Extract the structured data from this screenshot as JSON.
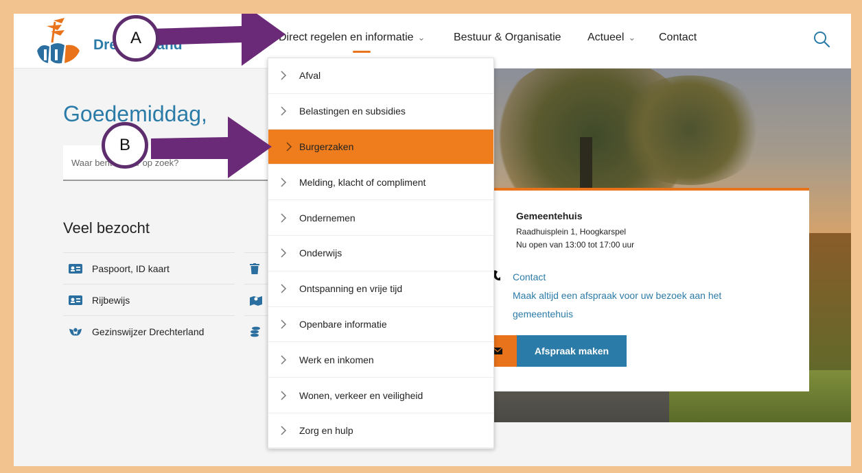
{
  "header": {
    "logo_text": "Drechterland",
    "nav": [
      {
        "label": "Direct regelen en informatie",
        "has_chevron": true
      },
      {
        "label": "Bestuur & Organisatie",
        "has_chevron": false
      },
      {
        "label": "Actueel",
        "has_chevron": true
      },
      {
        "label": "Contact",
        "has_chevron": false
      }
    ],
    "search_icon": "search-icon"
  },
  "main": {
    "greeting": "Goedemiddag,",
    "search_placeholder": "Waar bent u naar op zoek?",
    "popular_title": "Veel bezocht",
    "popular_items": [
      {
        "label": "Paspoort, ID kaart",
        "icon": "id-card-icon"
      },
      {
        "label": "Rijbewijs",
        "icon": "id-card-icon"
      },
      {
        "label": "Gezinswijzer Drechterland",
        "icon": "family-icon"
      }
    ],
    "popular_items_col2_icons": [
      "trash-icon",
      "map-icon",
      "coins-icon"
    ]
  },
  "dropdown": {
    "items": [
      "Afval",
      "Belastingen en subsidies",
      "Burgerzaken",
      "Melding, klacht of compliment",
      "Ondernemen",
      "Onderwijs",
      "Ontspanning en vrije tijd",
      "Openbare informatie",
      "Werk en inkomen",
      "Wonen, verkeer en veiligheid",
      "Zorg en hulp"
    ],
    "highlighted": "Burgerzaken"
  },
  "info_card": {
    "title": "Gemeentehuis",
    "address": "Raadhuisplein 1, Hoogkarspel",
    "hours": "Nu open van 13:00 tot 17:00 uur",
    "contact_link": "Contact",
    "appointment_note_line1": "Maak altijd een afspraak voor uw bezoek aan het",
    "appointment_note_line2": "gemeentehuis",
    "appointment_button": "Afspraak maken"
  },
  "annotations": {
    "a_label": "A",
    "b_label": "B"
  },
  "colors": {
    "frame": "#f2c28f",
    "brand_blue": "#2b7ba8",
    "accent_orange": "#e8731a",
    "annotation_purple": "#6b2a78"
  }
}
